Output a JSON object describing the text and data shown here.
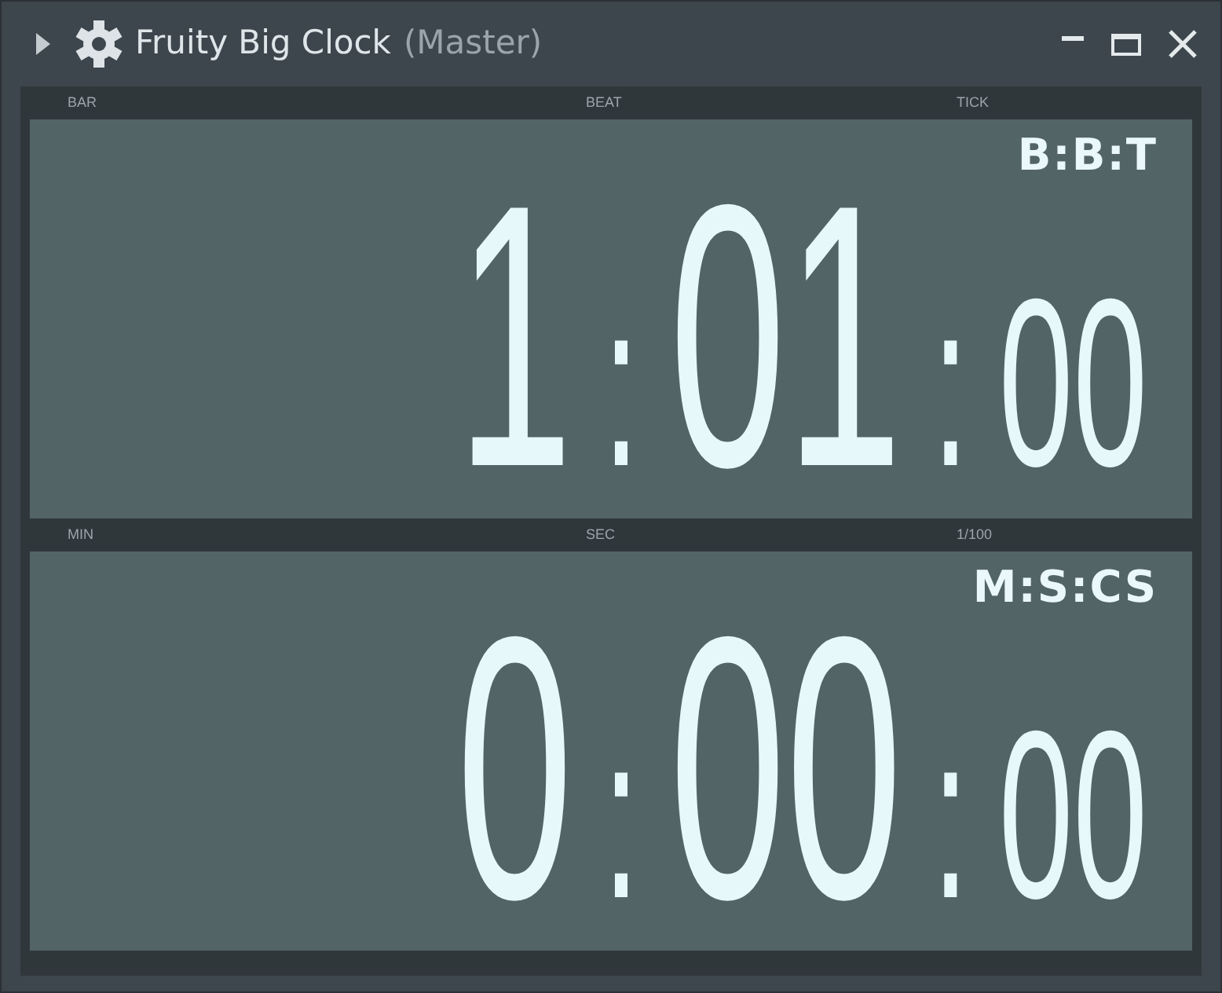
{
  "window": {
    "title": "Fruity Big Clock",
    "subtitle": "(Master)"
  },
  "clocks": [
    {
      "labels": [
        "BAR",
        "BEAT",
        "TICK"
      ],
      "mode": "B:B:T",
      "segments": [
        {
          "kind": "major",
          "text": "1"
        },
        {
          "kind": "colon",
          "text": ":"
        },
        {
          "kind": "major",
          "text": "01"
        },
        {
          "kind": "colon",
          "text": ":"
        },
        {
          "kind": "minor",
          "text": "00"
        }
      ]
    },
    {
      "labels": [
        "MIN",
        "SEC",
        "1/100"
      ],
      "mode": "M:S:CS",
      "segments": [
        {
          "kind": "major",
          "text": "0"
        },
        {
          "kind": "colon",
          "text": ":"
        },
        {
          "kind": "major",
          "text": "00"
        },
        {
          "kind": "colon",
          "text": ":"
        },
        {
          "kind": "minor",
          "text": "00"
        }
      ]
    }
  ]
}
